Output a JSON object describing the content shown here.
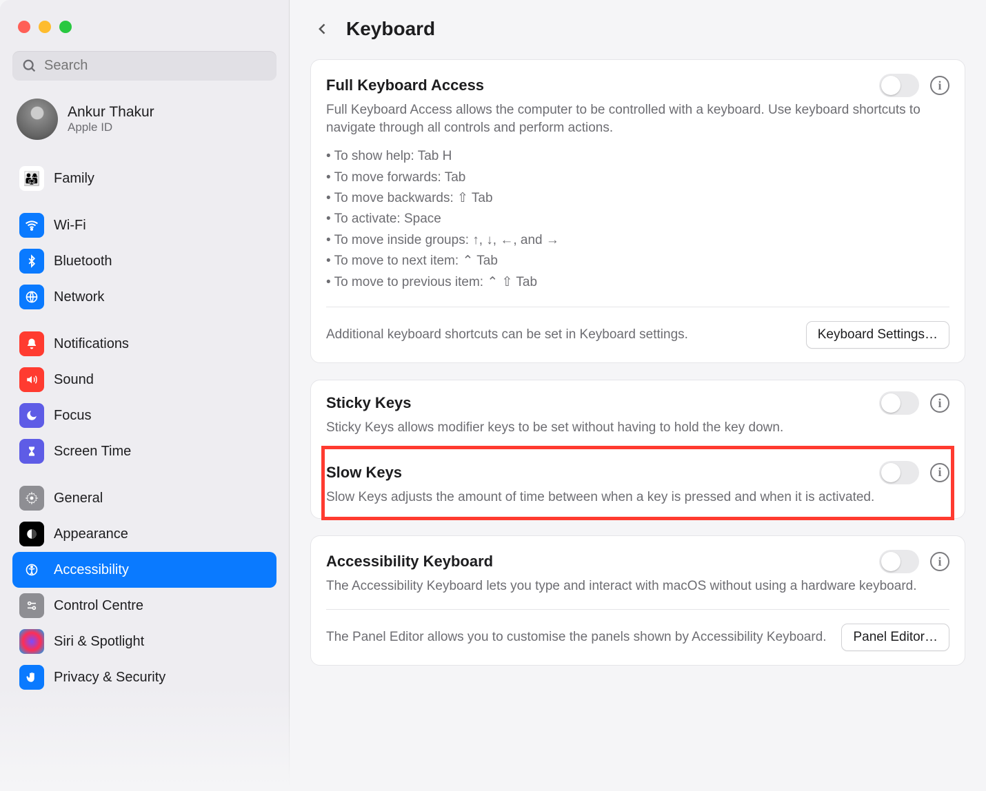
{
  "search": {
    "placeholder": "Search"
  },
  "profile": {
    "name": "Ankur Thakur",
    "subtitle": "Apple ID"
  },
  "sidebar": {
    "items": [
      {
        "label": "Family"
      },
      {
        "label": "Wi-Fi"
      },
      {
        "label": "Bluetooth"
      },
      {
        "label": "Network"
      },
      {
        "label": "Notifications"
      },
      {
        "label": "Sound"
      },
      {
        "label": "Focus"
      },
      {
        "label": "Screen Time"
      },
      {
        "label": "General"
      },
      {
        "label": "Appearance"
      },
      {
        "label": "Accessibility"
      },
      {
        "label": "Control Centre"
      },
      {
        "label": "Siri & Spotlight"
      },
      {
        "label": "Privacy & Security"
      }
    ]
  },
  "header": {
    "title": "Keyboard"
  },
  "fka": {
    "title": "Full Keyboard Access",
    "desc": "Full Keyboard Access allows the computer to be controlled with a keyboard. Use keyboard shortcuts to navigate through all controls and perform actions.",
    "bullets": [
      "• To show help: Tab H",
      "• To move forwards: Tab",
      "• To move backwards: ⇧ Tab",
      "• To activate: Space",
      "• To move inside groups: ↑, ↓, ←, and →",
      "• To move to next item: ⌃ Tab",
      "• To move to previous item: ⌃ ⇧ Tab"
    ],
    "footnote": "Additional keyboard shortcuts can be set in Keyboard settings.",
    "button": "Keyboard Settings…"
  },
  "sticky": {
    "title": "Sticky Keys",
    "desc": "Sticky Keys allows modifier keys to be set without having to hold the key down."
  },
  "slow": {
    "title": "Slow Keys",
    "desc": "Slow Keys adjusts the amount of time between when a key is pressed and when it is activated."
  },
  "acckb": {
    "title": "Accessibility Keyboard",
    "desc": "The Accessibility Keyboard lets you type and interact with macOS without using a hardware keyboard.",
    "footnote": "The Panel Editor allows you to customise the panels shown by Accessibility Keyboard.",
    "button": "Panel Editor…"
  }
}
